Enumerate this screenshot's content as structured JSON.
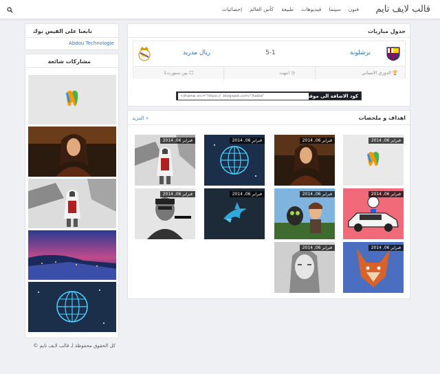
{
  "site": {
    "title": "قالب لايف تايم"
  },
  "nav": {
    "items": [
      "إحصائيات",
      "كأس العالم",
      "طبيعة",
      "فيديوهات",
      "سينما",
      "فنون"
    ]
  },
  "matches": {
    "title": "جدول مباريات",
    "home_team": "برشلونة",
    "away_team": "ريال مدريد",
    "score": "5-1",
    "league": "الدوري الاسباني",
    "status": "انتهت",
    "channel": "بين سبورت1"
  },
  "embed": {
    "label": "كود الاضافة الى موقعك :",
    "code": "<iframe src=\"https://                          .blogspot.com/\"/table\""
  },
  "goals": {
    "title": "اهداف و ملخصات",
    "more": "المزيد »",
    "items": [
      {
        "date": "فبراير 06, 2014",
        "subject": "tooth-logo"
      },
      {
        "date": "فبراير 06, 2014",
        "subject": "woman-portrait"
      },
      {
        "date": "فبراير 06, 2014",
        "subject": "globe-network"
      },
      {
        "date": "فبراير 06, 2014",
        "subject": "assassin-warrior"
      },
      {
        "date": "فبراير 06, 2014",
        "subject": "police-car"
      },
      {
        "date": "فبراير 06, 2014",
        "subject": "dragon-animation"
      },
      {
        "date": "فبراير 06, 2014",
        "subject": "shark-logo"
      },
      {
        "date": "فبراير 06, 2014",
        "subject": "soldier-bw"
      },
      {
        "date": "فبراير 06, 2014",
        "subject": "fox-art"
      },
      {
        "date": "فبراير 06, 2014",
        "subject": "woman-bw"
      }
    ]
  },
  "sidebar": {
    "facebook_title": "تابعنا على الفيس بوك",
    "facebook_link": "Abdou Technologie",
    "popular_title": "مشاركات شائعة"
  },
  "footer": {
    "copyright": "كل الحقوق محفوظة لـ قالب لايف تايم ©"
  },
  "colors": {
    "accent": "#2a6fb0",
    "background": "#eef0f3"
  }
}
